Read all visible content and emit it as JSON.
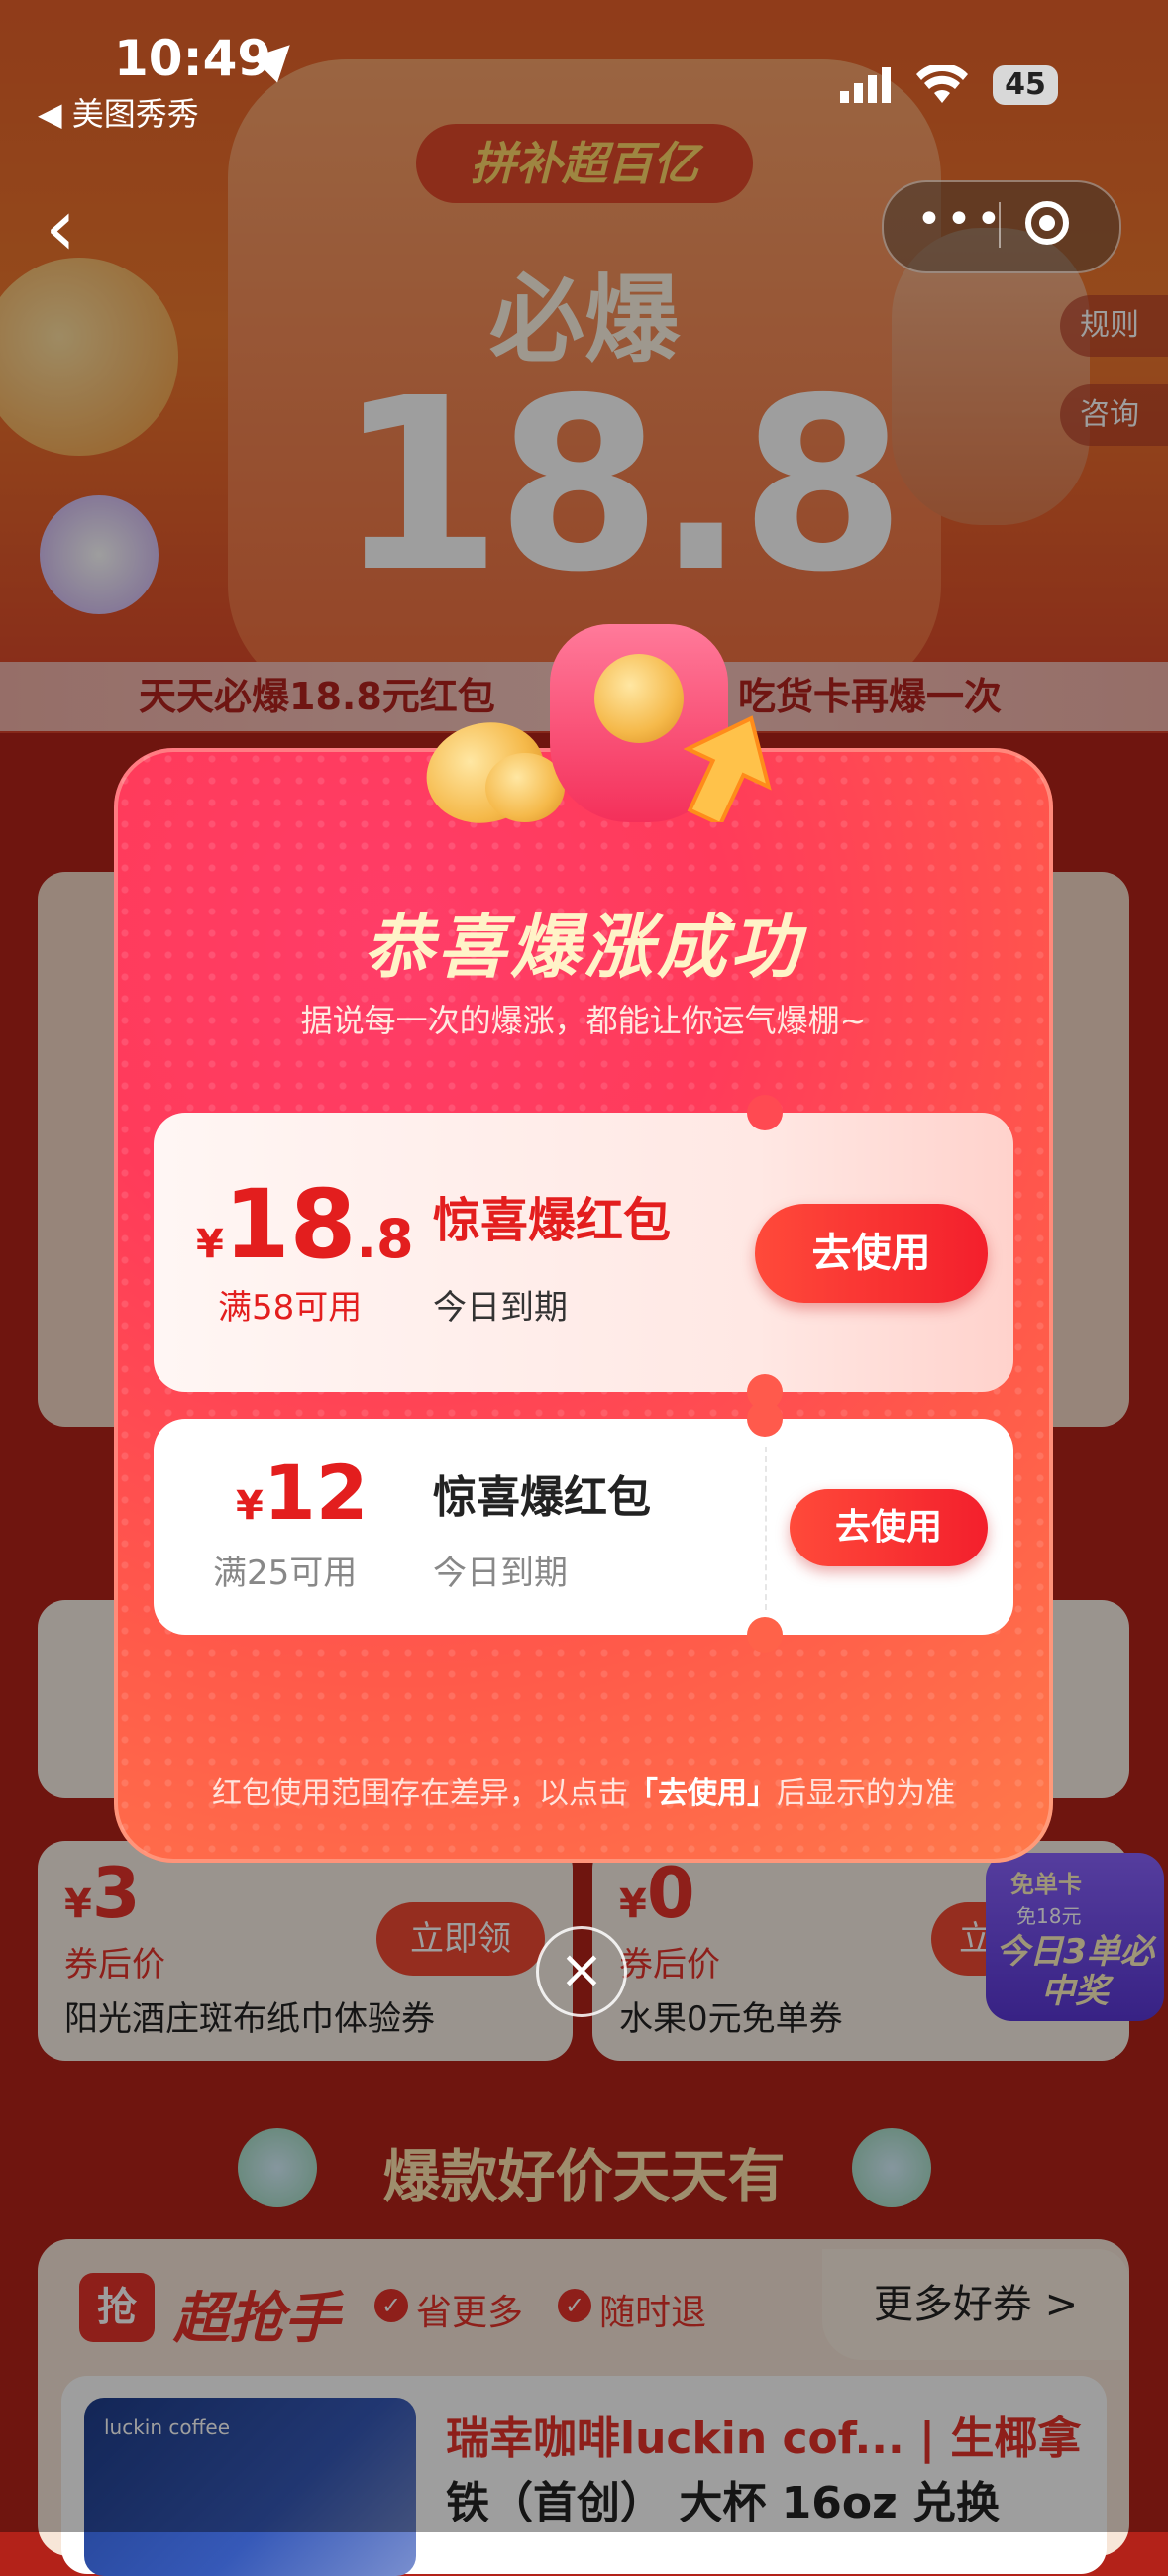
{
  "status_bar": {
    "time": "10:49",
    "back_app": "美图秀秀",
    "battery": "45"
  },
  "hero": {
    "badge": "拼补超百亿",
    "headline": "必爆",
    "amount": "18.8",
    "ribbon_left": "天天必爆18.8元红包",
    "ribbon_right": "吃货卡再爆一次",
    "side_tabs": [
      "规则",
      "咨询"
    ]
  },
  "background_coupons": [
    {
      "price": "3",
      "label": "券后价",
      "title": "阳光酒庄斑布纸巾体验券",
      "button": "立即领"
    },
    {
      "price": "0",
      "label": "券后价",
      "title": "水果0元免单券",
      "button": "立"
    }
  ],
  "promo_badge": {
    "top": "免单卡",
    "mid": "免18元",
    "main": "今日3单必中奖"
  },
  "section": {
    "title": "爆款好价天天有"
  },
  "grab": {
    "icon": "抢",
    "title": "超抢手",
    "tags": [
      "省更多",
      "随时退"
    ],
    "more": "更多好券 >",
    "product_brand": "luckin coffee",
    "product_name": "瑞幸咖啡luckin cof... | 生椰拿",
    "product_sub": "铁（首创） 大杯 16oz 兑换"
  },
  "popup": {
    "title": "恭喜爆涨成功",
    "subtitle": "据说每一次的爆涨，都能让你运气爆棚~",
    "coupons": [
      {
        "yen": "¥",
        "amount_int": "18",
        "amount_dec": ".8",
        "condition": "满58可用",
        "title": "惊喜爆红包",
        "expiry": "今日到期",
        "button": "去使用"
      },
      {
        "yen": "¥",
        "amount_int": "12",
        "amount_dec": "",
        "condition": "满25可用",
        "title": "惊喜爆红包",
        "expiry": "今日到期",
        "button": "去使用"
      }
    ],
    "note_prefix": "红包使用范围存在差异，以点击",
    "note_highlight": "「去使用」",
    "note_suffix": "后显示的为准"
  },
  "colors": {
    "accent": "#e31e1e",
    "popup": "#ff3b5a",
    "background": "#b32219"
  }
}
